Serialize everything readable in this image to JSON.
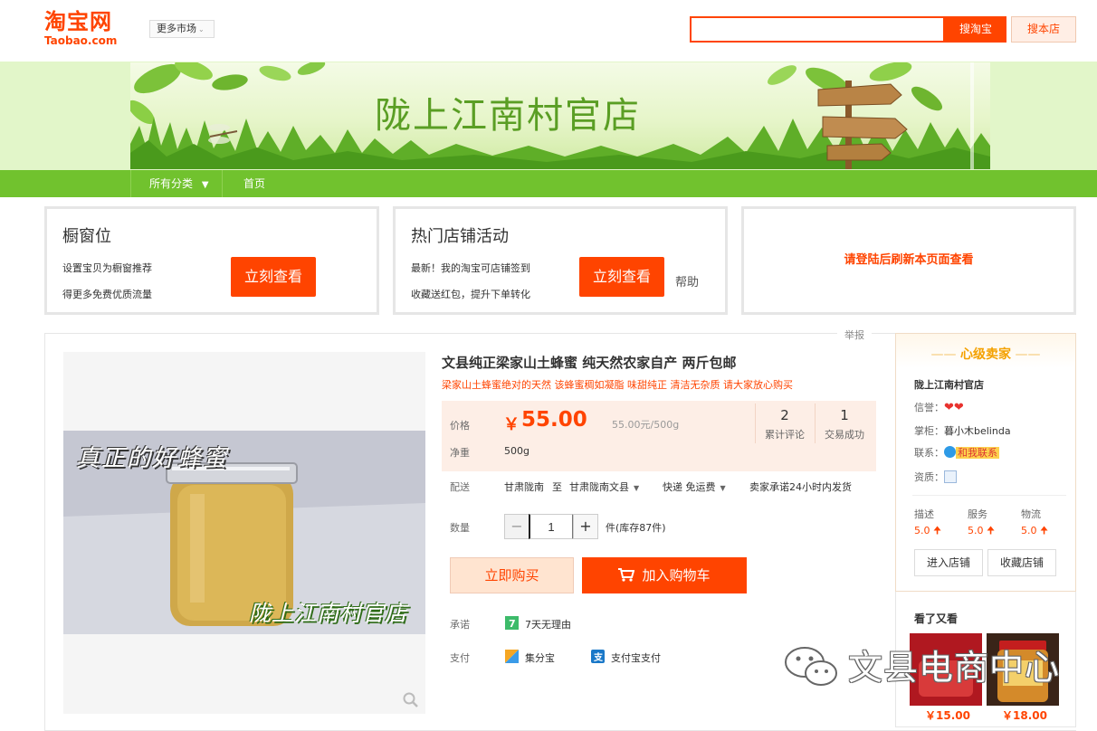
{
  "header": {
    "logo_cn": "淘宝网",
    "logo_en": "Taobao.com",
    "more_market": "更多市场",
    "search_value": "",
    "search_taobao_btn": "搜淘宝",
    "search_shop_btn": "搜本店"
  },
  "banner": {
    "shop_title": "陇上江南村官店"
  },
  "nav": {
    "all_categories": "所有分类",
    "home": "首页"
  },
  "promos": [
    {
      "title": "橱窗位",
      "line1": "设置宝贝为橱窗推荐",
      "line2": "得更多免费优质流量",
      "button": "立刻查看"
    },
    {
      "title": "热门店铺活动",
      "line1": "最新！我的淘宝可店铺签到",
      "line2": "收藏送红包，提升下单转化",
      "button": "立刻查看",
      "help": "帮助"
    },
    {
      "text": "请登陆后刷新本页面查看"
    }
  ],
  "item": {
    "report": "举报",
    "title": "文县纯正梁家山土蜂蜜 纯天然农家自产 两斤包邮",
    "subtitle": "梁家山土蜂蜜绝对的天然 该蜂蜜稠如凝脂 味甜纯正 清洁无杂质 请大家放心购买",
    "photo_caption_top": "真正的好蜂蜜",
    "photo_caption_bottom": "陇上江南村官店",
    "price_label": "价格",
    "currency": "￥",
    "price": "55.00",
    "unit_price": "55.00元/500g",
    "weight_label": "净重",
    "weight": "500g",
    "reviews_count": "2",
    "reviews_label": "累计评论",
    "deals_count": "1",
    "deals_label": "交易成功",
    "delivery_label": "配送",
    "delivery_from": "甘肃陇南",
    "delivery_to_word": "至",
    "delivery_to": "甘肃陇南文县",
    "shipping": "快递 免运费",
    "shipping_promise": "卖家承诺24小时内发货",
    "qty_label": "数量",
    "qty_value": "1",
    "stock_text": "件(库存87件)",
    "buy_now": "立即购买",
    "add_to_cart": "加入购物车",
    "promise_label": "承诺",
    "promise_item": "7天无理由",
    "pay_label": "支付",
    "pay_option_1": "集分宝",
    "pay_option_2": "支付宝支付"
  },
  "seller": {
    "level": "心级卖家",
    "shop_name": "陇上江南村官店",
    "credit_label": "信誉：",
    "keeper_label": "掌柜：",
    "keeper": "暮小木belinda",
    "contact_label": "联系：",
    "contact_btn": "和我联系",
    "qualification_label": "资质：",
    "ratings": [
      {
        "label": "描述",
        "value": "5.0"
      },
      {
        "label": "服务",
        "value": "5.0"
      },
      {
        "label": "物流",
        "value": "5.0"
      }
    ],
    "enter_shop": "进入店铺",
    "favorite_shop": "收藏店铺"
  },
  "also_viewed": {
    "title": "看了又看",
    "items": [
      {
        "price": "￥15.00"
      },
      {
        "price": "￥18.00"
      }
    ]
  },
  "watermark": {
    "text": "文县电商中心"
  },
  "colors": {
    "brand": "#ff4400",
    "nav_green": "#71c22e",
    "price_bg": "#fdeee6"
  }
}
